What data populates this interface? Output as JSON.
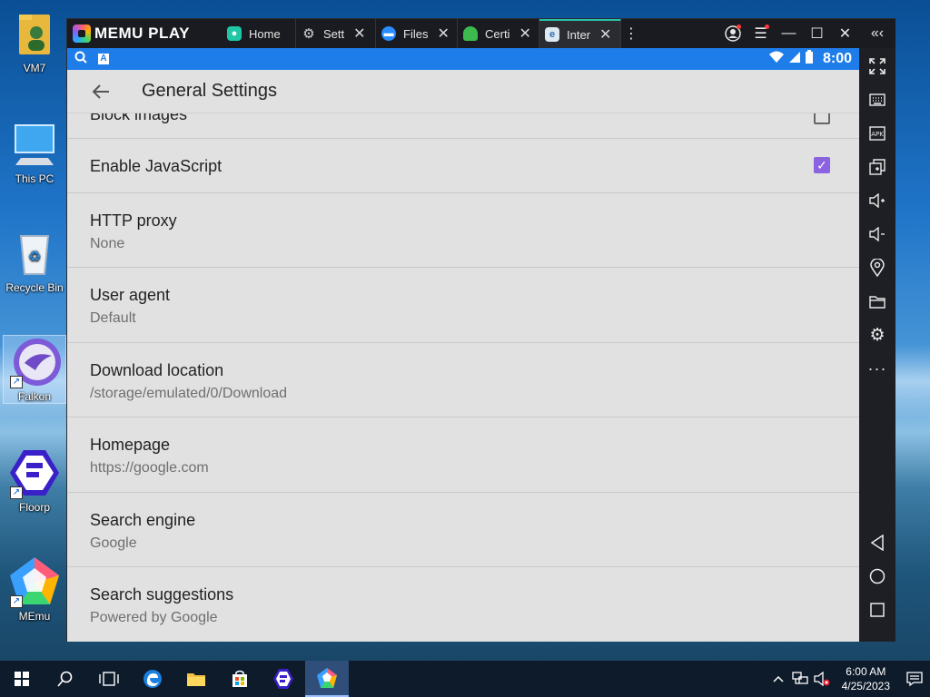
{
  "desktop": {
    "icons": [
      {
        "label": "VM7"
      },
      {
        "label": "This PC"
      },
      {
        "label": "Recycle Bin"
      },
      {
        "label": "Falkon"
      },
      {
        "label": "Floorp"
      },
      {
        "label": "MEmu"
      }
    ]
  },
  "emulator": {
    "app_name": "MEMU PLAY",
    "tabs": [
      {
        "label": "Home",
        "icon": "home-app-icon",
        "color": "#1fc7a4"
      },
      {
        "label": "Sett",
        "icon": "settings-gear-icon",
        "color": "#7a7f8a"
      },
      {
        "label": "Files",
        "icon": "files-app-icon",
        "color": "#2a8cff"
      },
      {
        "label": "Certi",
        "icon": "android-icon",
        "color": "#3dba4e"
      },
      {
        "label": "Inter",
        "icon": "browser-icon",
        "color": "#5aa0d8"
      }
    ],
    "status": {
      "time": "8:00"
    },
    "android": {
      "page_title": "General Settings",
      "settings": [
        {
          "title": "Block images",
          "checkbox": false
        },
        {
          "title": "Enable JavaScript",
          "checkbox": true
        },
        {
          "title": "HTTP proxy",
          "subtitle": "None"
        },
        {
          "title": "User agent",
          "subtitle": "Default"
        },
        {
          "title": "Download location",
          "subtitle": "/storage/emulated/0/Download"
        },
        {
          "title": "Homepage",
          "subtitle": "https://google.com"
        },
        {
          "title": "Search engine",
          "subtitle": "Google"
        },
        {
          "title": "Search suggestions",
          "subtitle": "Powered by Google"
        }
      ]
    }
  },
  "taskbar": {
    "time": "6:00 AM",
    "date": "4/25/2023"
  },
  "colors": {
    "android_statusbar": "#1f7de9",
    "checkbox_accent": "#8b62e0",
    "active_tab_accent": "#27c2a8",
    "taskbar_bg": "#0e1b2b"
  }
}
